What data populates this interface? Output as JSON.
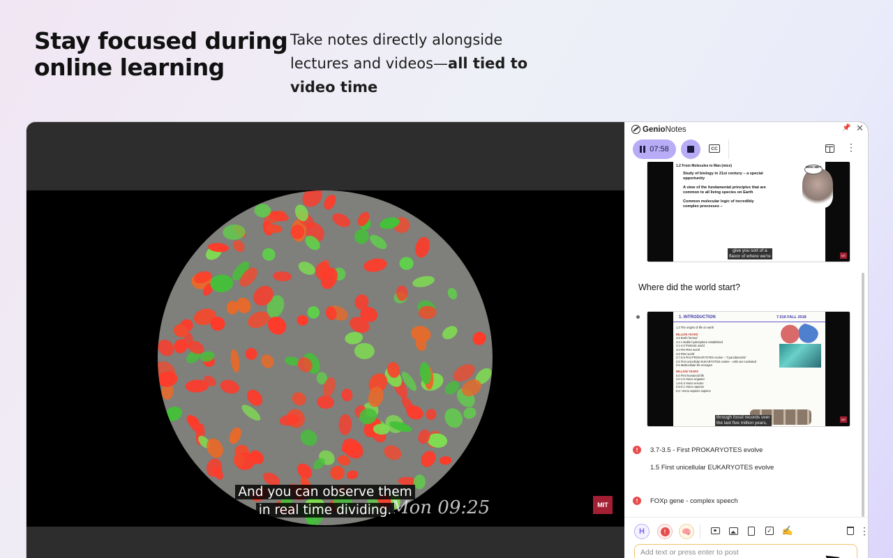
{
  "hero": {
    "headline_line1": "Stay focused during",
    "headline_line2": "online learning",
    "sub_line1": "Take notes directly alongside",
    "sub_line2_plain": "lectures and videos—",
    "sub_line2_bold": "all tied to",
    "sub_line3_bold": "video time"
  },
  "video": {
    "caption_line1": "And you can observe them",
    "caption_line2": "in real time dividing.",
    "timestamp_overlay": "Mon 09:25",
    "logo_text": "MIT"
  },
  "panel": {
    "brand_prefix": "Genio",
    "brand_suffix": "Notes",
    "pin_icon": "pin-icon",
    "close_icon": "close-icon",
    "toolbar": {
      "pause_time": "07:58",
      "cc_label": "CC",
      "more_glyph": "⋮"
    },
    "slide1": {
      "title": "1.2 From Molecules to Man (mice)",
      "bullet1": "Study of biology in 21st century – a special opportunity",
      "bullet2": "A view of the fundamental principles that are common to all living species on Earth",
      "bullet3": "Common molecular logic of incredibly complex processes –",
      "speech": "WHO ME?",
      "subtitle_line1": "give you sort of a",
      "subtitle_line2": "flavor of where we're",
      "logo": "MIT"
    },
    "question": "Where did the world start?",
    "slide2": {
      "header_left": "1. INTRODUCTION",
      "header_right": "7.016 FALL 2018",
      "subtitle": "1.3 The origins of life on earth",
      "billion_label": "BILLION YEARS",
      "rows": [
        "4.5  Earth formed",
        "4.2  A stable hydrosphere established",
        "4.1-4.0  Prebiotic world",
        "4.0  Pre-RNA world",
        "3.8  RNA world",
        "3.7-3.5  First PROKARYOTES evolve – \"Cyanobacteria\"",
        "3.5  First unicellular EUKARYOTES evolve – cells are nucleated",
        "0.5  Multicellular life emerges"
      ],
      "million_label": "MILLION YEARS",
      "rows2": [
        "5.0  First humanoid life",
        "2.0-1.0  Homo ergaster",
        "1.6-0.3  Homo erectus",
        "0.5-0.1  Homo sapiens",
        "0.2-  Homo sapiens sapiens"
      ],
      "subtitle_line1": "through fossil records over",
      "subtitle_line2": "the last five million years,",
      "logo": "MIT"
    },
    "notes": [
      {
        "icon": "alert-icon",
        "text": "3.7-3.5 - First PROKARYOTES evolve"
      },
      {
        "icon": "",
        "text": "1.5 First unicellular EUKARYOTES evolve"
      },
      {
        "icon": "alert-icon",
        "text": "FOXp gene - complex speech"
      }
    ],
    "bottom_tools": {
      "heading_label": "H",
      "alert_label": "!",
      "brain_glyph": "🧠",
      "pen_glyph": "✍",
      "more_glyph": "⋮"
    },
    "input": {
      "placeholder": "Add text or press enter to post",
      "value": ""
    }
  },
  "colors": {
    "accent_purple": "#b8acf6",
    "alert_red": "#e74c4c",
    "input_border": "#f0c36a",
    "mit_red": "#a31f34"
  }
}
